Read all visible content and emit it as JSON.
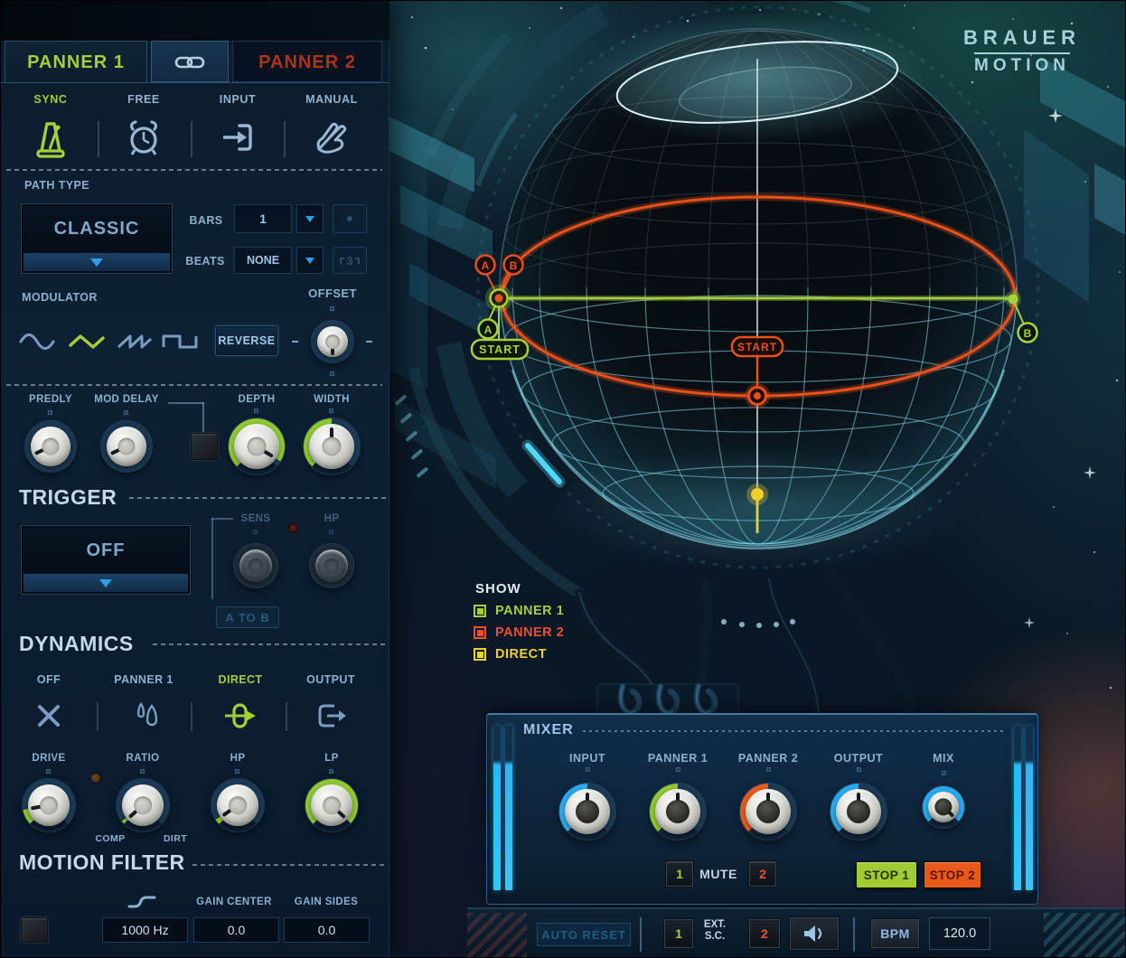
{
  "brand": {
    "line1": "BRAUER",
    "line2": "MOTION"
  },
  "tabs": {
    "panner1": "PANNER 1",
    "panner2": "PANNER 2"
  },
  "modes": {
    "sync": "SYNC",
    "free": "FREE",
    "input": "INPUT",
    "manual": "MANUAL"
  },
  "path": {
    "label": "PATH TYPE",
    "value": "CLASSIC",
    "bars_label": "BARS",
    "bars_value": "1",
    "beats_label": "BEATS",
    "beats_value": "NONE",
    "triplet": "3"
  },
  "modulator": {
    "label": "MODULATOR",
    "reverse": "REVERSE",
    "offset": "OFFSET"
  },
  "mod_row": {
    "predly": "PREDLY",
    "mod_delay": "MOD DELAY",
    "depth": "DEPTH",
    "width": "WIDTH"
  },
  "trigger": {
    "header": "TRIGGER",
    "value": "OFF",
    "sens": "SENS",
    "hp": "HP",
    "a_to_b": "A TO B"
  },
  "dynamics": {
    "header": "DYNAMICS",
    "modes": [
      "OFF",
      "PANNER 1",
      "DIRECT",
      "OUTPUT"
    ],
    "drive": "DRIVE",
    "ratio": "RATIO",
    "hp": "HP",
    "lp": "LP",
    "comp": "COMP",
    "dirt": "DIRT"
  },
  "motion_filter": {
    "header": "MOTION FILTER",
    "freq": "1000 Hz",
    "gain_center_label": "GAIN CENTER",
    "gain_center_value": "0.0",
    "gain_sides_label": "GAIN SIDES",
    "gain_sides_value": "0.0"
  },
  "markers": {
    "orange_a": "A",
    "orange_b": "B",
    "green_a": "A",
    "green_b": "B",
    "green_start": "START",
    "orange_start": "START"
  },
  "show": {
    "label": "SHOW",
    "items": [
      {
        "label": "PANNER 1",
        "color": "#a6ce39"
      },
      {
        "label": "PANNER 2",
        "color": "#e8522a"
      },
      {
        "label": "DIRECT",
        "color": "#ecd22c"
      }
    ]
  },
  "mixer": {
    "header": "MIXER",
    "knob_labels": [
      "INPUT",
      "PANNER 1",
      "PANNER 2",
      "OUTPUT",
      "MIX"
    ],
    "mute_one": "1",
    "mute_label": "MUTE",
    "mute_two": "2",
    "stop1": "STOP 1",
    "stop2": "STOP 2",
    "stop1_color": "#9fcc33",
    "stop2_color": "#e85818"
  },
  "transport": {
    "auto_reset": "AUTO RESET",
    "sc_one": "1",
    "ext_line1": "EXT.",
    "ext_line2": "S.C.",
    "sc_two": "2",
    "bpm_label": "BPM",
    "bpm_value": "120.0"
  },
  "knob_values": {
    "offset": {
      "angle": 180,
      "val": 0,
      "plain": true
    },
    "predly": {
      "angle": -115,
      "val": 0,
      "plain": true
    },
    "mod_delay": {
      "angle": -115,
      "val": 0,
      "plain": true
    },
    "depth": {
      "angle": 122,
      "val": 257,
      "color": "#8fc832"
    },
    "width": {
      "angle": 0,
      "val": 135,
      "color": "#8fc832"
    },
    "drive": {
      "angle": -100,
      "val": 35,
      "color": "#8fc832"
    },
    "ratio": {
      "angle": -132,
      "val": 8,
      "color": "#8fc832"
    },
    "dyn_hp": {
      "angle": -125,
      "val": 12,
      "color": "#8fc832"
    },
    "dyn_lp": {
      "angle": 133,
      "val": 268,
      "color": "#8fc832"
    },
    "mixer_input": {
      "angle": 0,
      "val": 135,
      "color": "#2aa9ef"
    },
    "mixer_p1": {
      "angle": 0,
      "val": 135,
      "color": "#8fc832"
    },
    "mixer_p2": {
      "angle": 0,
      "val": 135,
      "color": "#e85a1a"
    },
    "mixer_out": {
      "angle": 0,
      "val": 135,
      "color": "#2aa9ef"
    },
    "mixer_mix": {
      "angle": 133,
      "val": 268,
      "color": "#2aa9ef"
    }
  },
  "colors": {
    "green": "#a6ce39",
    "orange": "#e8511c",
    "blue": "#2aa9ef",
    "yellow": "#f2ce2c"
  }
}
